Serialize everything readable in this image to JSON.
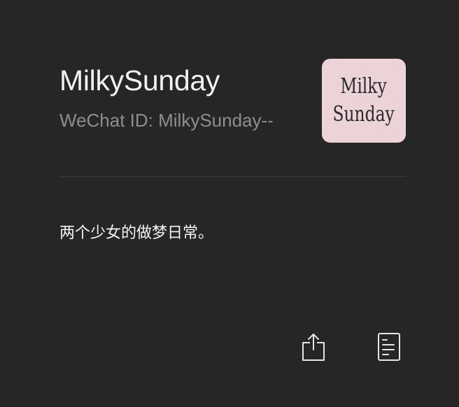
{
  "profile": {
    "name": "MilkySunday",
    "wechat_id_label": "WeChat ID: MilkySunday--",
    "bio": "两个少女的做梦日常。",
    "avatar": {
      "line1": "Milky",
      "line2": "Sunday",
      "background": "#ecd3d7"
    }
  },
  "actions": {
    "share_icon": "share-icon",
    "report_icon": "document-icon"
  },
  "colors": {
    "background": "#262626",
    "title": "#f2f2f2",
    "secondary_text": "#8e8e8e",
    "divider": "#3b3b3b"
  }
}
